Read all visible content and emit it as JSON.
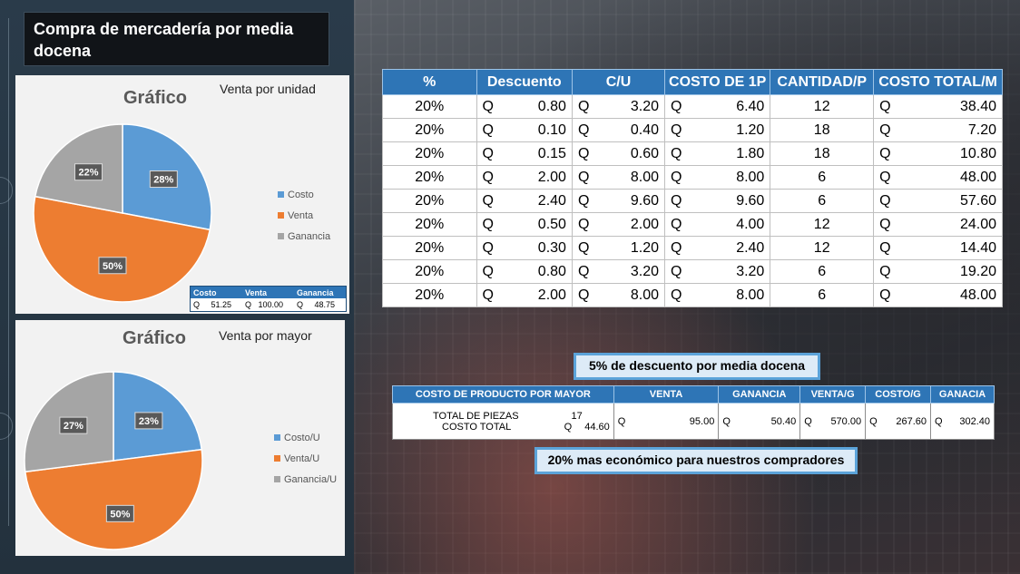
{
  "title": "Compra de mercadería por media docena",
  "colors": {
    "costo": "#5b9bd5",
    "venta": "#ed7d31",
    "ganancia": "#a5a5a5",
    "header": "#2e75b6"
  },
  "chart1": {
    "title": "Gráfico",
    "subtitle": "Venta por unidad",
    "legend": [
      "Costo",
      "Venta",
      "Ganancia"
    ],
    "table": {
      "headers": [
        "Costo",
        "Venta",
        "Ganancia"
      ],
      "values": [
        "Q     51.25",
        "Q   100.00",
        "Q     48.75"
      ]
    }
  },
  "chart2": {
    "title": "Gráfico",
    "subtitle": "Venta por mayor",
    "legend": [
      "Costo/U",
      "Venta/U",
      "Ganancia/U"
    ]
  },
  "chart_data": [
    {
      "type": "pie",
      "title": "Gráfico",
      "categories": [
        "Costo",
        "Venta",
        "Ganancia"
      ],
      "values": [
        28,
        50,
        22
      ],
      "labels": [
        "28%",
        "50%",
        "22%"
      ]
    },
    {
      "type": "pie",
      "title": "Gráfico",
      "categories": [
        "Costo/U",
        "Venta/U",
        "Ganancia/U"
      ],
      "values": [
        23,
        50,
        27
      ],
      "labels": [
        "23%",
        "50%",
        "27%"
      ]
    }
  ],
  "main_table": {
    "headers": [
      "%",
      "Descuento",
      "C/U",
      "COSTO DE 1P",
      "CANTIDAD/P",
      "COSTO TOTAL/M"
    ],
    "rows": [
      [
        "20%",
        "0.80",
        "3.20",
        "6.40",
        "12",
        "38.40"
      ],
      [
        "20%",
        "0.10",
        "0.40",
        "1.20",
        "18",
        "7.20"
      ],
      [
        "20%",
        "0.15",
        "0.60",
        "1.80",
        "18",
        "10.80"
      ],
      [
        "20%",
        "2.00",
        "8.00",
        "8.00",
        "6",
        "48.00"
      ],
      [
        "20%",
        "2.40",
        "9.60",
        "9.60",
        "6",
        "57.60"
      ],
      [
        "20%",
        "0.50",
        "2.00",
        "4.00",
        "12",
        "24.00"
      ],
      [
        "20%",
        "0.30",
        "1.20",
        "2.40",
        "12",
        "14.40"
      ],
      [
        "20%",
        "0.80",
        "3.20",
        "3.20",
        "6",
        "19.20"
      ],
      [
        "20%",
        "2.00",
        "8.00",
        "8.00",
        "6",
        "48.00"
      ]
    ],
    "currency": "Q"
  },
  "banner1": "5% de descuento por media docena",
  "banner2": "20% mas económico para nuestros compradores",
  "summary": {
    "headers": [
      "COSTO DE PRODUCTO POR MAYOR",
      "VENTA",
      "GANANCIA",
      "VENTA/G",
      "COSTO/G",
      "GANACIA"
    ],
    "total_piezas_label": "TOTAL DE PIEZAS",
    "total_piezas_value": "17",
    "costo_total_label": "COSTO TOTAL",
    "costo_total_currency": "Q",
    "costo_total_value": "44.60",
    "venta": "95.00",
    "ganancia": "50.40",
    "venta_g": "570.00",
    "costo_g": "267.60",
    "ganacia": "302.40",
    "currency": "Q"
  }
}
